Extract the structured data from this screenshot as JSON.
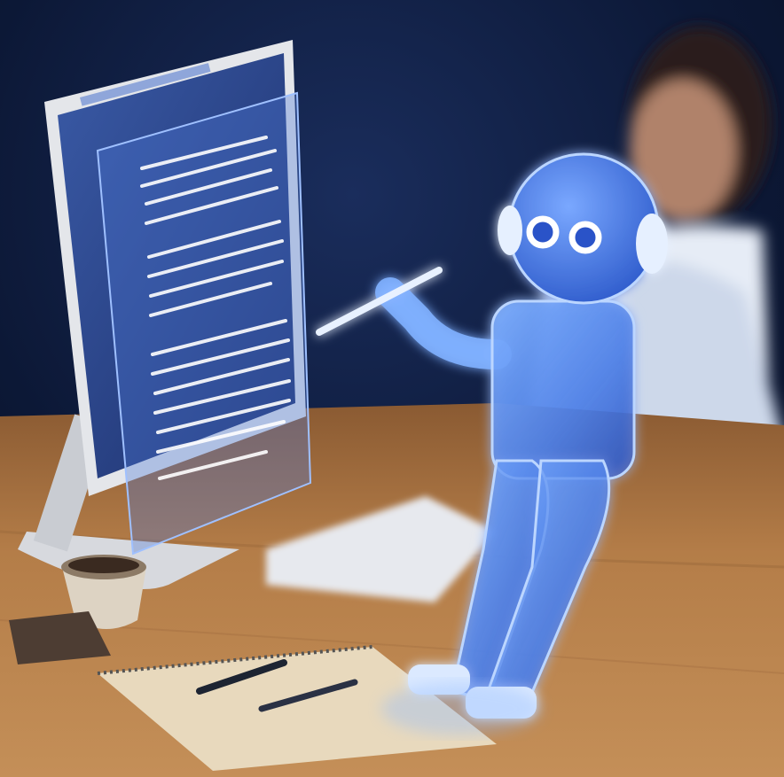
{
  "scene": {
    "description_name": "ai-robot-assistant-at-desk",
    "colors": {
      "background_dark": "#0a1530",
      "glow_blue": "#3a7bff",
      "robot_light": "#cfe2ff",
      "desk_wood": "#b07a45",
      "paper": "#e9dcc2"
    },
    "objects": [
      {
        "name": "computer-monitor",
        "interactable": false
      },
      {
        "name": "holographic-document",
        "interactable": false
      },
      {
        "name": "glowing-robot",
        "interactable": false
      },
      {
        "name": "robot-pen",
        "interactable": false
      },
      {
        "name": "person-typing",
        "interactable": false
      },
      {
        "name": "keyboard",
        "interactable": false
      },
      {
        "name": "coffee-cup",
        "interactable": false
      },
      {
        "name": "notebook",
        "interactable": false
      },
      {
        "name": "pen",
        "interactable": false
      },
      {
        "name": "desk",
        "interactable": false
      }
    ]
  }
}
